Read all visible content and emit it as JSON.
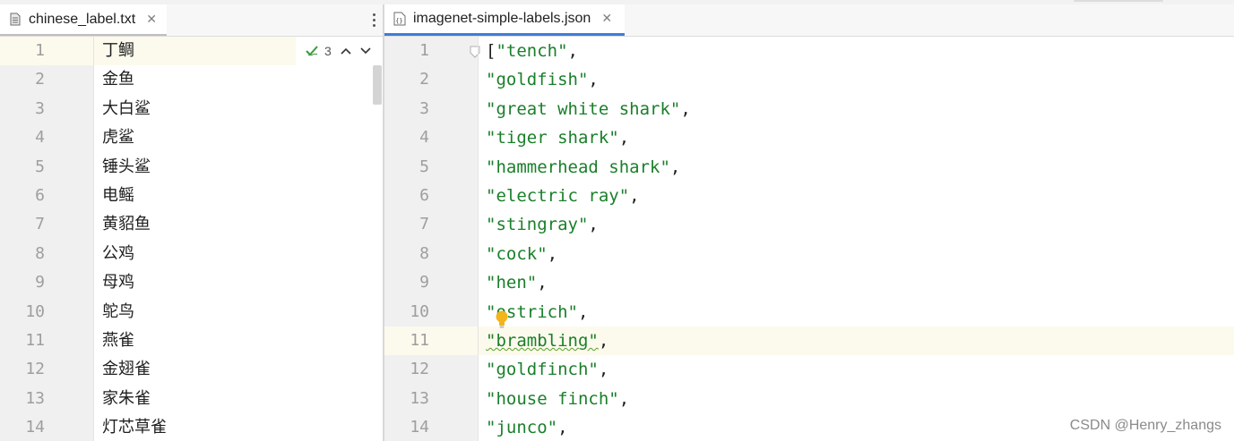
{
  "left_pane": {
    "tab_label": "chinese_label.txt",
    "close_glyph": "✕",
    "inspection_count": "3",
    "lines": [
      {
        "n": "1",
        "text": "丁鲷"
      },
      {
        "n": "2",
        "text": "金鱼"
      },
      {
        "n": "3",
        "text": "大白鲨"
      },
      {
        "n": "4",
        "text": "虎鲨"
      },
      {
        "n": "5",
        "text": "锤头鲨"
      },
      {
        "n": "6",
        "text": "电鳐"
      },
      {
        "n": "7",
        "text": "黄貂鱼"
      },
      {
        "n": "8",
        "text": "公鸡"
      },
      {
        "n": "9",
        "text": "母鸡"
      },
      {
        "n": "10",
        "text": "鸵鸟"
      },
      {
        "n": "11",
        "text": "燕雀"
      },
      {
        "n": "12",
        "text": "金翅雀"
      },
      {
        "n": "13",
        "text": "家朱雀"
      },
      {
        "n": "14",
        "text": "灯芯草雀"
      }
    ]
  },
  "right_pane": {
    "tab_label": "imagenet-simple-labels.json",
    "close_glyph": "✕",
    "lines": [
      {
        "n": "1",
        "pre": "[",
        "str": "\"tench\"",
        "post": ","
      },
      {
        "n": "2",
        "pre": "",
        "str": "\"goldfish\"",
        "post": ","
      },
      {
        "n": "3",
        "pre": "",
        "str": "\"great white shark\"",
        "post": ","
      },
      {
        "n": "4",
        "pre": "",
        "str": "\"tiger shark\"",
        "post": ","
      },
      {
        "n": "5",
        "pre": "",
        "str": "\"hammerhead shark\"",
        "post": ","
      },
      {
        "n": "6",
        "pre": "",
        "str": "\"electric ray\"",
        "post": ","
      },
      {
        "n": "7",
        "pre": "",
        "str": "\"stingray\"",
        "post": ","
      },
      {
        "n": "8",
        "pre": "",
        "str": "\"cock\"",
        "post": ","
      },
      {
        "n": "9",
        "pre": "",
        "str": "\"hen\"",
        "post": ","
      },
      {
        "n": "10",
        "pre": "",
        "str": "\"ostrich\"",
        "post": ","
      },
      {
        "n": "11",
        "pre": "",
        "str": "\"brambling\"",
        "post": ","
      },
      {
        "n": "12",
        "pre": "",
        "str": "\"goldfinch\"",
        "post": ","
      },
      {
        "n": "13",
        "pre": "",
        "str": "\"house finch\"",
        "post": ","
      },
      {
        "n": "14",
        "pre": "",
        "str": "\"junco\"",
        "post": ","
      }
    ]
  },
  "watermark": "CSDN @Henry_zhangs",
  "colors": {
    "string": "#1a7f2a",
    "active_tab_underline": "#3d7ddb",
    "current_line": "#fcfaed",
    "gutter": "#f0f0f0"
  },
  "icons": {
    "left_tab": "text-file-icon",
    "right_tab": "json-file-icon",
    "inspection": "check-icon",
    "prev": "chevron-up-icon",
    "next": "chevron-down-icon",
    "menu": "more-vertical-icon",
    "intention": "lightbulb-icon",
    "fold": "fold-marker-icon"
  }
}
